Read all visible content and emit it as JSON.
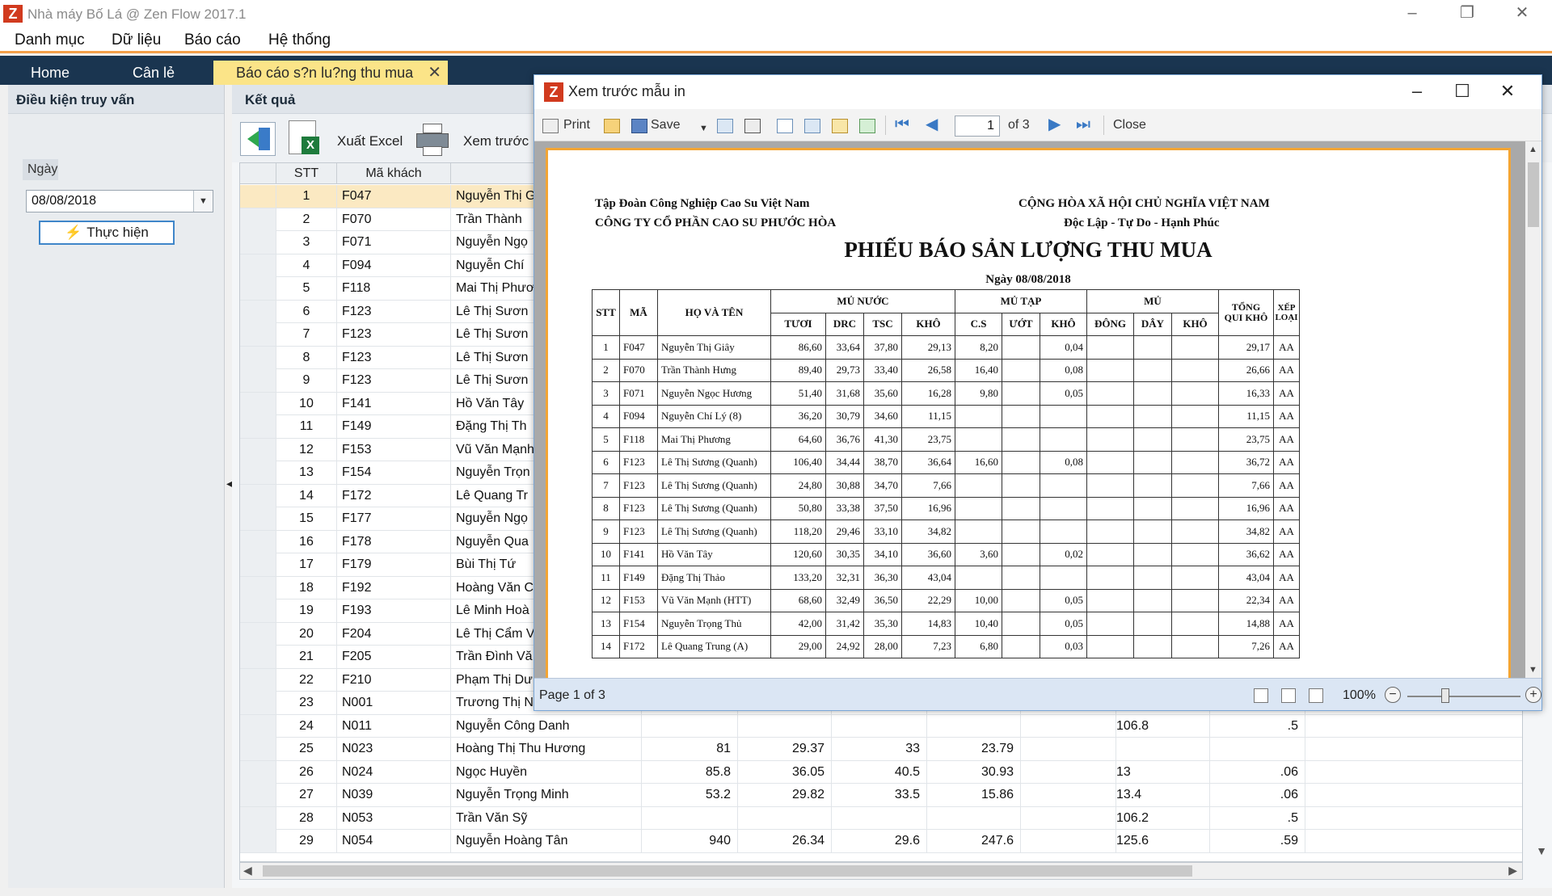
{
  "window": {
    "title": "Nhà máy Bố Lá @ Zen Flow 2017.1",
    "logo": "Z"
  },
  "menu": [
    "Danh mục",
    "Dữ liệu",
    "Báo cáo",
    "Hệ thống"
  ],
  "tabs": [
    {
      "label": "Home"
    },
    {
      "label": "Cân lẻ"
    },
    {
      "label": "Báo cáo s?n lu?ng thu mua",
      "close": "✕"
    }
  ],
  "query_panel": {
    "title": "Điều kiện truy vấn",
    "date_label": "Ngày",
    "date_value": "08/08/2018",
    "run_label": "Thực hiện"
  },
  "results": {
    "title": "Kết quả",
    "export_label": "Xuất Excel",
    "preview_label": "Xem trước",
    "headers": [
      "STT",
      "Mã khách",
      "Tê"
    ],
    "rows": [
      [
        "1",
        "F047",
        "Nguyễn Thị G",
        "",
        "",
        "",
        "",
        "",
        "",
        ""
      ],
      [
        "2",
        "F070",
        "Trần Thành",
        "",
        "",
        "",
        "",
        "",
        "",
        ""
      ],
      [
        "3",
        "F071",
        "Nguyễn Ngọ",
        "",
        "",
        "",
        "",
        "",
        "",
        ""
      ],
      [
        "4",
        "F094",
        "Nguyễn Chí",
        "",
        "",
        "",
        "",
        "",
        "",
        ""
      ],
      [
        "5",
        "F118",
        "Mai Thị Phươ",
        "",
        "",
        "",
        "",
        "",
        "",
        ""
      ],
      [
        "6",
        "F123",
        "Lê Thị Sươn",
        "",
        "",
        "",
        "",
        "",
        "",
        ""
      ],
      [
        "7",
        "F123",
        "Lê Thị Sươn",
        "",
        "",
        "",
        "",
        "",
        "",
        ""
      ],
      [
        "8",
        "F123",
        "Lê Thị Sươn",
        "",
        "",
        "",
        "",
        "",
        "",
        ""
      ],
      [
        "9",
        "F123",
        "Lê Thị Sươn",
        "",
        "",
        "",
        "",
        "",
        "",
        ""
      ],
      [
        "10",
        "F141",
        "Hồ Văn Tây",
        "",
        "",
        "",
        "",
        "",
        "",
        ""
      ],
      [
        "11",
        "F149",
        "Đặng Thị Th",
        "",
        "",
        "",
        "",
        "",
        "",
        ""
      ],
      [
        "12",
        "F153",
        "Vũ Văn Mạnh",
        "",
        "",
        "",
        "",
        "",
        "",
        ""
      ],
      [
        "13",
        "F154",
        "Nguyễn Trọn",
        "",
        "",
        "",
        "",
        "",
        "",
        ""
      ],
      [
        "14",
        "F172",
        "Lê Quang Tr",
        "",
        "",
        "",
        "",
        "",
        "",
        ""
      ],
      [
        "15",
        "F177",
        "Nguyễn Ngọ",
        "",
        "",
        "",
        "",
        "",
        "",
        ""
      ],
      [
        "16",
        "F178",
        "Nguyễn Qua",
        "",
        "",
        "",
        "",
        "",
        "",
        ""
      ],
      [
        "17",
        "F179",
        "Bùi Thị Tứ",
        "",
        "",
        "",
        "",
        "",
        "",
        ""
      ],
      [
        "18",
        "F192",
        "Hoàng Văn C",
        "",
        "",
        "",
        "",
        "",
        "",
        ""
      ],
      [
        "19",
        "F193",
        "Lê Minh Hoà",
        "",
        "",
        "",
        "",
        "",
        "",
        ""
      ],
      [
        "20",
        "F204",
        "Lê Thị Cẩm V",
        "",
        "",
        "",
        "",
        "",
        "",
        ""
      ],
      [
        "21",
        "F205",
        "Trần Đình Vă",
        "",
        "",
        "",
        "",
        "",
        "",
        ""
      ],
      [
        "22",
        "F210",
        "Phạm Thị Dư",
        "",
        "",
        "",
        "",
        "",
        "",
        ""
      ],
      [
        "23",
        "N001",
        "Trương Thị N",
        "",
        "",
        "",
        "",
        "",
        "",
        ""
      ],
      [
        "24",
        "N011",
        "Nguyễn Công Danh",
        "",
        "",
        "",
        "",
        "",
        "106.8",
        ".5"
      ],
      [
        "25",
        "N023",
        "Hoàng Thị Thu Hương",
        "81",
        "29.37",
        "33",
        "23.79",
        "",
        "",
        ""
      ],
      [
        "26",
        "N024",
        "Ngọc Huyền",
        "85.8",
        "36.05",
        "40.5",
        "30.93",
        "",
        "13",
        ".06"
      ],
      [
        "27",
        "N039",
        "Nguyễn Trọng Minh",
        "53.2",
        "29.82",
        "33.5",
        "15.86",
        "",
        "13.4",
        ".06"
      ],
      [
        "28",
        "N053",
        "Trần Văn Sỹ",
        "",
        "",
        "",
        "",
        "",
        "106.2",
        ".5"
      ],
      [
        "29",
        "N054",
        "Nguyễn Hoàng Tân",
        "940",
        "26.34",
        "29.6",
        "247.6",
        "",
        "125.6",
        ".59"
      ]
    ]
  },
  "preview": {
    "title": "Xem trước mẫu in",
    "toolbar": {
      "print": "Print",
      "save": "Save",
      "page_value": "1",
      "page_of": "of 3",
      "close": "Close"
    },
    "status": {
      "page_text": "Page 1 of 3",
      "zoom": "100%"
    },
    "document": {
      "left_line1": "Tập Đoàn Công Nghiệp Cao Su Việt Nam",
      "left_line2": "CÔNG TY CỔ PHẦN CAO SU PHƯỚC HÒA",
      "right_line1": "CỘNG HÒA XÃ HỘI CHỦ NGHĨA VIỆT NAM",
      "right_line2": "Độc Lập - Tự Do - Hạnh Phúc",
      "title": "PHIẾU BÁO SẢN LƯỢNG THU MUA",
      "date": "Ngày 08/08/2018",
      "group_headers": [
        "MỦ NƯỚC",
        "MỦ TẠP",
        "MỦ"
      ],
      "col_stt": "STT",
      "col_ma": "MÃ",
      "col_hoten": "HỌ VÀ TÊN",
      "sub_headers": [
        "TƯƠI",
        "DRC",
        "TSC",
        "KHÔ",
        "C.S",
        "ƯỚT",
        "KHÔ",
        "ĐÔNG",
        "DÂY",
        "KHÔ"
      ],
      "col_tong": "TỔNG QUI KHÔ",
      "col_xeploai": "XẾP LOẠI",
      "rows": [
        [
          "1",
          "F047",
          "Nguyễn Thị Giây",
          "86,60",
          "33,64",
          "37,80",
          "29,13",
          "8,20",
          "",
          "0,04",
          "",
          "",
          "",
          "29,17",
          "AA"
        ],
        [
          "2",
          "F070",
          "Trần Thành Hưng",
          "89,40",
          "29,73",
          "33,40",
          "26,58",
          "16,40",
          "",
          "0,08",
          "",
          "",
          "",
          "26,66",
          "AA"
        ],
        [
          "3",
          "F071",
          "Nguyễn Ngọc Hương",
          "51,40",
          "31,68",
          "35,60",
          "16,28",
          "9,80",
          "",
          "0,05",
          "",
          "",
          "",
          "16,33",
          "AA"
        ],
        [
          "4",
          "F094",
          "Nguyễn Chí Lý (8)",
          "36,20",
          "30,79",
          "34,60",
          "11,15",
          "",
          "",
          "",
          "",
          "",
          "",
          "11,15",
          "AA"
        ],
        [
          "5",
          "F118",
          "Mai Thị Phương",
          "64,60",
          "36,76",
          "41,30",
          "23,75",
          "",
          "",
          "",
          "",
          "",
          "",
          "23,75",
          "AA"
        ],
        [
          "6",
          "F123",
          "Lê Thị Sương (Quanh)",
          "106,40",
          "34,44",
          "38,70",
          "36,64",
          "16,60",
          "",
          "0,08",
          "",
          "",
          "",
          "36,72",
          "AA"
        ],
        [
          "7",
          "F123",
          "Lê Thị Sương (Quanh)",
          "24,80",
          "30,88",
          "34,70",
          "7,66",
          "",
          "",
          "",
          "",
          "",
          "",
          "7,66",
          "AA"
        ],
        [
          "8",
          "F123",
          "Lê Thị Sương (Quanh)",
          "50,80",
          "33,38",
          "37,50",
          "16,96",
          "",
          "",
          "",
          "",
          "",
          "",
          "16,96",
          "AA"
        ],
        [
          "9",
          "F123",
          "Lê Thị Sương (Quanh)",
          "118,20",
          "29,46",
          "33,10",
          "34,82",
          "",
          "",
          "",
          "",
          "",
          "",
          "34,82",
          "AA"
        ],
        [
          "10",
          "F141",
          "Hồ Văn Tây",
          "120,60",
          "30,35",
          "34,10",
          "36,60",
          "3,60",
          "",
          "0,02",
          "",
          "",
          "",
          "36,62",
          "AA"
        ],
        [
          "11",
          "F149",
          "Đặng Thị Thảo",
          "133,20",
          "32,31",
          "36,30",
          "43,04",
          "",
          "",
          "",
          "",
          "",
          "",
          "43,04",
          "AA"
        ],
        [
          "12",
          "F153",
          "Vũ Văn Mạnh (HTT)",
          "68,60",
          "32,49",
          "36,50",
          "22,29",
          "10,00",
          "",
          "0,05",
          "",
          "",
          "",
          "22,34",
          "AA"
        ],
        [
          "13",
          "F154",
          "Nguyễn Trọng Thủ",
          "42,00",
          "31,42",
          "35,30",
          "14,83",
          "10,40",
          "",
          "0,05",
          "",
          "",
          "",
          "14,88",
          "AA"
        ],
        [
          "14",
          "F172",
          "Lê Quang Trung (A)",
          "29,00",
          "24,92",
          "28,00",
          "7,23",
          "6,80",
          "",
          "0,03",
          "",
          "",
          "",
          "7,26",
          "AA"
        ]
      ]
    }
  },
  "colors": {
    "accent": "#f3a04a",
    "tab_bg": "#1a3550",
    "active_tab": "#fbe488",
    "selection": "#fbe9c2"
  }
}
